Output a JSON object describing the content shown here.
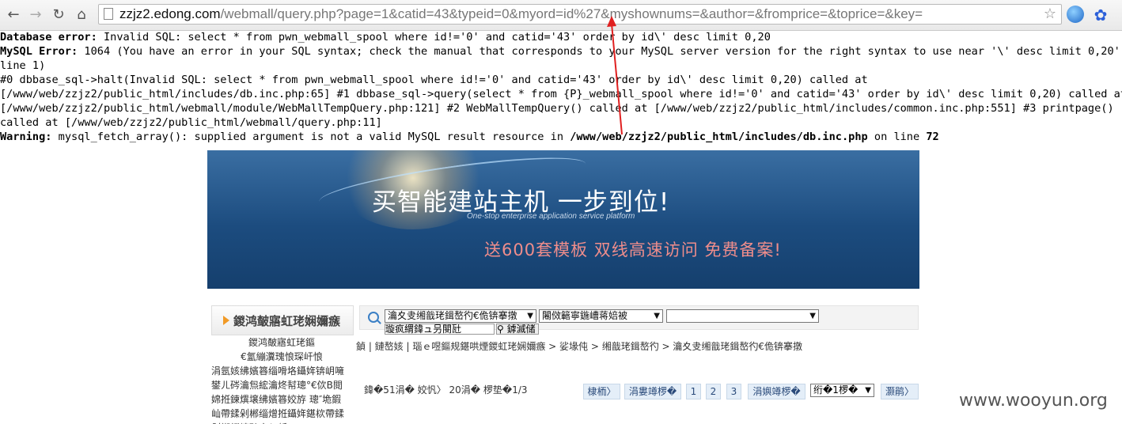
{
  "browser": {
    "url_host": "zzjz2.edong.com",
    "url_path": "/webmall/query.php?page=1&catid=43&typeid=0&myord=id%27&myshownums=&author=&fromprice=&toprice=&key=",
    "icons": [
      "back-icon",
      "forward-icon",
      "reload-icon",
      "home-icon",
      "page-icon",
      "star-icon",
      "globe-icon",
      "baidu-paw-icon"
    ]
  },
  "errors": {
    "line1_label": "Database error:",
    "line1_text": " Invalid SQL: select * from pwn_webmall_spool where id!='0' and catid='43' order by id\\' desc limit 0,20",
    "line2_label": "MySQL Error:",
    "line2_text": " 1064 (You have an error in your SQL syntax; check the manual that corresponds to your MySQL server version for the right syntax to use near '\\' desc limit 0,20' at",
    "line3": "line 1)",
    "line4": "#0 dbbase_sql->halt(Invalid SQL: select * from pwn_webmall_spool where id!='0' and catid='43' order by id\\' desc limit 0,20) called at",
    "line5": "[/www/web/zzjz2/public_html/includes/db.inc.php:65] #1 dbbase_sql->query(select * from {P}_webmall_spool where id!='0' and catid='43' order by id\\' desc limit 0,20) called at",
    "line6": "[/www/web/zzjz2/public_html/webmall/module/WebMallTempQuery.php:121] #2 WebMallTempQuery() called at [/www/web/zzjz2/public_html/includes/common.inc.php:551] #3 printpage()",
    "line7": "called at [/www/web/zzjz2/public_html/webmall/query.php:11]",
    "warning_label": "Warning:",
    "warning_text": " mysql_fetch_array(): supplied argument is not a valid MySQL result resource in ",
    "warning_path": "/www/web/zzjz2/public_html/includes/db.inc.php",
    "warning_mid": " on line ",
    "warning_line": "72"
  },
  "banner": {
    "title": "买智能建站主机  一步到位!",
    "subtitle": "One-stop enterprise application service platform",
    "promo": "送600套模板  双线高速访问  免费备案!"
  },
  "sidebar": {
    "title": "鍐鸿皶寤虹珯娴嬭瘯",
    "items": [
      "鍐鸿皶寤虹珯鏂",
      "€氳繃瀵瑰悢琛屽悢"
    ],
    "body": "涓氬姟绋嬪簭缁嗗垎鑷姩锛岄噰鐢ㄦ硶瀹炰綋瀹炵幇璁°€佽В閲婂拰鍊熼壌绋嬪簭姣斿  璁″垝鍜屾帶鍒剁郴缁熷拰鑷姩鍖栨帶鍒剁郴缁熺殑宸ヤ綔"
  },
  "search": {
    "select1": "瀹夊叏缃戠珯鍓嶅彴€佹锛搴撴",
    "select2": "闂傚簵寧鍦嶆蒋婄被",
    "select3": "",
    "keyword": "璇疯緭鍏ュ叧閿瓧",
    "button": "鎼滅储"
  },
  "breadcrumb": "鍞 | 鏈嶅姟 | 瑙ｅ喅鏂规鍖哄煙鍐虹珯娴嬭瘯 > 娑堟伅 > 缃戠珯鍓嶅彴 > 瀹夊叏缃戠珯鍓嶅彴€佹锛搴撴",
  "pagination": {
    "info": "鍏�51涓� 姣忛〉 20涓� 椤垫�1/3",
    "first": "棣栭〉",
    "prev": "涓婁竴椤�",
    "pages": [
      "1",
      "2",
      "3"
    ],
    "next": "涓嬩竴椤�",
    "jump": "绗�1椤�",
    "last": "灏鹃〉"
  },
  "watermark": "www.wooyun.org",
  "colors": {
    "arrow": "#e02020",
    "banner_bg": "#1c4c7f",
    "promo": "#ef8d8b",
    "accent": "#f19a26"
  }
}
